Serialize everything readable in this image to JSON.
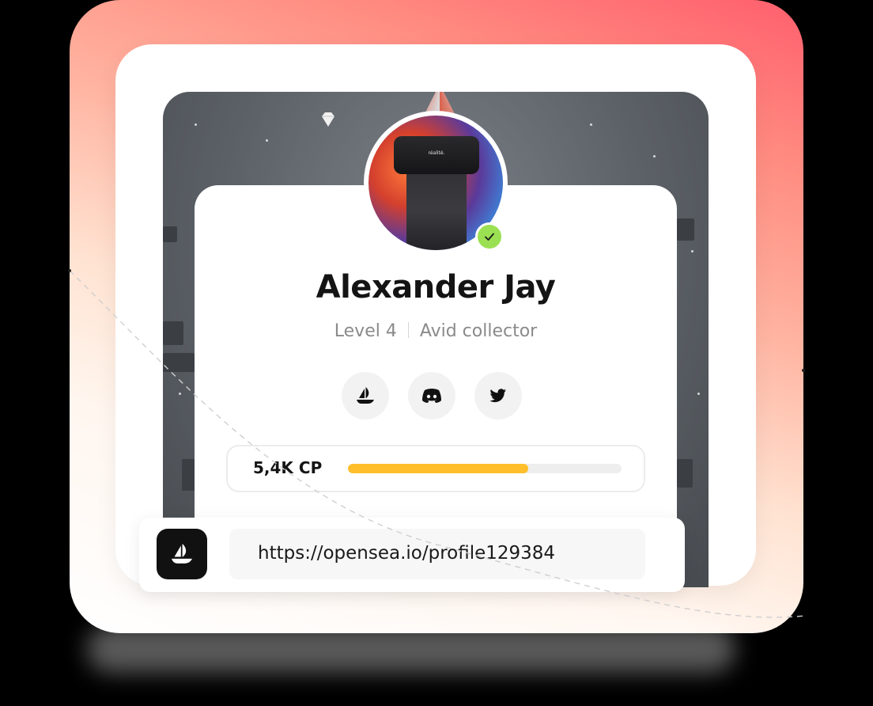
{
  "profile": {
    "name": "Alexander Jay",
    "level": "Level 4",
    "role": "Avid collector",
    "verified": true,
    "avatar_visor_text": "réalité."
  },
  "social": [
    {
      "icon": "opensea-icon"
    },
    {
      "icon": "discord-icon"
    },
    {
      "icon": "twitter-icon"
    }
  ],
  "points": {
    "label": "5,4K CP",
    "progress_fraction": 0.66
  },
  "url_bar": {
    "icon": "opensea-icon",
    "url": "https://opensea.io/profile129384"
  },
  "colors": {
    "accent_progress": "#ffbf2c",
    "verified_badge": "#9be052",
    "backdrop_top": "#ff5f6d"
  }
}
